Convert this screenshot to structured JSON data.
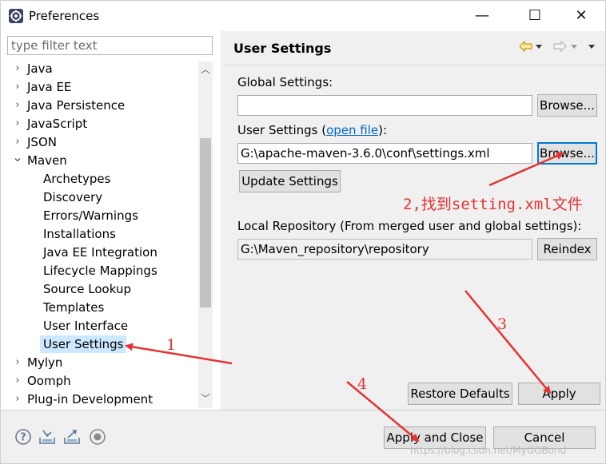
{
  "window": {
    "title": "Preferences",
    "minimize_glyph": "—",
    "maximize_glyph": "☐",
    "close_glyph": "✕"
  },
  "sidebar": {
    "filter_placeholder": "type filter text",
    "items": [
      {
        "label": "Java",
        "level": 0,
        "expanded": false
      },
      {
        "label": "Java EE",
        "level": 0,
        "expanded": false
      },
      {
        "label": "Java Persistence",
        "level": 0,
        "expanded": false
      },
      {
        "label": "JavaScript",
        "level": 0,
        "expanded": false
      },
      {
        "label": "JSON",
        "level": 0,
        "expanded": false
      },
      {
        "label": "Maven",
        "level": 0,
        "expanded": true
      },
      {
        "label": "Archetypes",
        "level": 1
      },
      {
        "label": "Discovery",
        "level": 1
      },
      {
        "label": "Errors/Warnings",
        "level": 1
      },
      {
        "label": "Installations",
        "level": 1
      },
      {
        "label": "Java EE Integration",
        "level": 1
      },
      {
        "label": "Lifecycle Mappings",
        "level": 1
      },
      {
        "label": "Source Lookup",
        "level": 1
      },
      {
        "label": "Templates",
        "level": 1
      },
      {
        "label": "User Interface",
        "level": 1
      },
      {
        "label": "User Settings",
        "level": 1,
        "selected": true
      },
      {
        "label": "Mylyn",
        "level": 0,
        "expanded": false
      },
      {
        "label": "Oomph",
        "level": 0,
        "expanded": false
      },
      {
        "label": "Plug-in Development",
        "level": 0,
        "expanded": false
      }
    ]
  },
  "page": {
    "title": "User Settings",
    "global_settings_label": "Global Settings:",
    "global_settings_value": "",
    "browse_label": "Browse...",
    "user_settings_label_prefix": "User Settings (",
    "user_settings_link": "open file",
    "user_settings_label_suffix": "):",
    "user_settings_value": "G:\\apache-maven-3.6.0\\conf\\settings.xml",
    "update_settings_label": "Update Settings",
    "local_repo_label": "Local Repository (From merged user and global settings):",
    "local_repo_value": "G:\\Maven_repository\\repository",
    "reindex_label": "Reindex",
    "restore_defaults_label": "Restore Defaults",
    "apply_label": "Apply"
  },
  "footer": {
    "apply_close_label": "Apply and Close",
    "cancel_label": "Cancel",
    "watermark": "https://blog.csdn.net/MyGGBond"
  },
  "annotations": {
    "one": "1",
    "two": "2,找到setting.xml文件",
    "three": "3",
    "four": "4"
  },
  "colors": {
    "annotation": "#e53333",
    "selection": "#cce8ff",
    "link": "#0066cc",
    "focus": "#0078d7"
  }
}
